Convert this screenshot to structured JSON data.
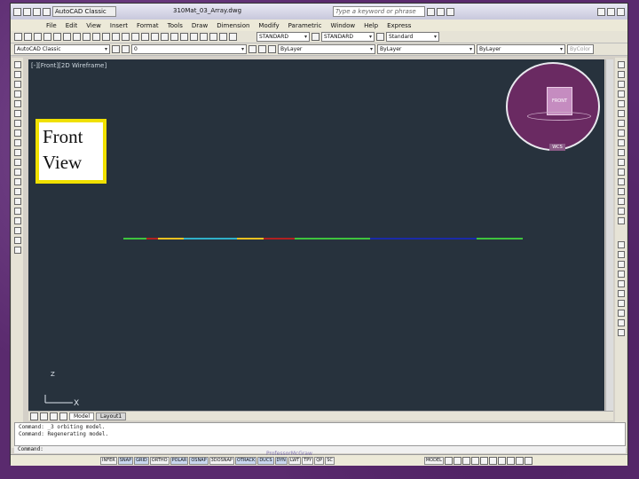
{
  "title": {
    "workspace": "AutoCAD Classic",
    "file": "310Mat_03_Array.dwg",
    "search_placeholder": "Type a keyword or phrase"
  },
  "menu": [
    "File",
    "Edit",
    "View",
    "Insert",
    "Format",
    "Tools",
    "Draw",
    "Dimension",
    "Modify",
    "Parametric",
    "Window",
    "Help",
    "Express"
  ],
  "toolbar": {
    "text_style": "STANDARD",
    "dim_style": "STANDARD",
    "table_style": "Standard",
    "workspace": "AutoCAD Classic",
    "layer": "0",
    "color": "ByLayer",
    "linetype": "ByLayer",
    "lineweight": "ByLayer",
    "plot_style": "ByColor"
  },
  "viewport": {
    "label": "[-][Front][2D Wireframe]",
    "caption_line1": "Front",
    "caption_line2": "View",
    "viewcube_face": "FRONT",
    "wcs": "WCS",
    "axis_y": "Z",
    "axis_x": "X"
  },
  "tabs": [
    "Model",
    "Layout1"
  ],
  "command": {
    "history": [
      "Command:  _3 orbiting model.",
      "Command:  Regenerating model."
    ],
    "prompt": "Command:"
  },
  "status": {
    "coords": "",
    "toggles": [
      "INFER",
      "SNAP",
      "GRID",
      "ORTHO",
      "POLAR",
      "OSNAP",
      "3DOSNAP",
      "OTRACK",
      "DUCS",
      "DYN",
      "LWT",
      "TPY",
      "QP",
      "SC"
    ],
    "on": [
      "SNAP",
      "GRID",
      "POLAR",
      "OSNAP",
      "OTRACK",
      "DUCS",
      "DYN"
    ],
    "model": "MODEL"
  },
  "watermark": "ProfessorMcGraw"
}
